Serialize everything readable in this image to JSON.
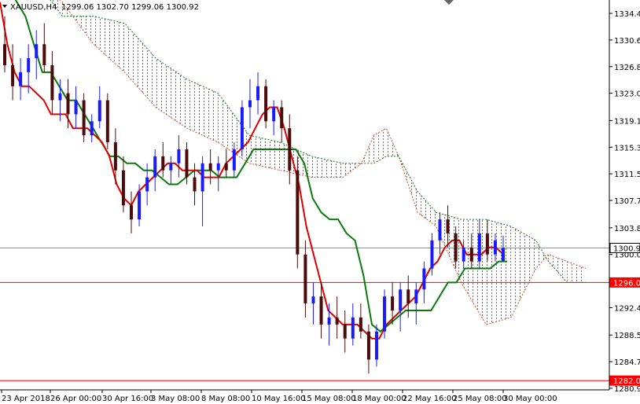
{
  "header": {
    "symbol": "XAUUSD,H4",
    "ohlc": "1299.06 1302.70 1299.06 1300.92"
  },
  "colors": {
    "bull_candle": "#1a1aff",
    "bear_candle": "#4d0a0a",
    "tenkan": "#e00000",
    "kijun": "#0a7a0a",
    "kumo_bear": "#d24a2a",
    "kumo_bull": "#2aa070",
    "horizontal_red": "#ff0000",
    "current_price_line": "#7a9c9c",
    "axis": "#000000"
  },
  "chart_data": {
    "type": "candlestick",
    "indicator": "Ichimoku Kinko Hyo",
    "ylim": [
      1280.9,
      1336.2
    ],
    "y_ticks": [
      1334.4,
      1330.6,
      1326.8,
      1323.0,
      1319.1,
      1315.3,
      1311.5,
      1307.7,
      1303.8,
      1300.0,
      1296.2,
      1292.4,
      1288.5,
      1284.7,
      1280.9
    ],
    "x_ticks": [
      "23 Apr 2018",
      "26 Apr 00:00",
      "30 Apr 16:00",
      "3 May 08:00",
      "8 May 08:00",
      "10 May 16:00",
      "15 May 08:00",
      "18 May 00:00",
      "22 May 16:00",
      "25 May 08:00",
      "30 May 00:00"
    ],
    "current_price": 1300.92,
    "horizontal_lines": [
      1296.0,
      1282.0
    ],
    "price_tags": [
      {
        "label": "1300.92",
        "value": 1300.92,
        "style": "current"
      },
      {
        "label": "1296.00",
        "value": 1296.0,
        "style": "red"
      },
      {
        "label": "1282.00",
        "value": 1282.0,
        "style": "red"
      }
    ],
    "close_points": [
      1332,
      1326,
      1330,
      1324,
      1322,
      1328,
      1332,
      1326,
      1324,
      1322,
      1320,
      1322,
      1318,
      1317,
      1320,
      1322,
      1318,
      1315,
      1313,
      1310,
      1306,
      1308,
      1306,
      1309,
      1313,
      1315,
      1313,
      1310,
      1312,
      1310,
      1312,
      1316,
      1314,
      1312,
      1314,
      1313,
      1312,
      1308,
      1311,
      1312,
      1314,
      1313,
      1316,
      1320,
      1322,
      1321,
      1318,
      1324,
      1322,
      1320,
      1318,
      1314,
      1312,
      1302,
      1294,
      1292,
      1293,
      1290,
      1291,
      1289,
      1289,
      1287,
      1286,
      1289,
      1291,
      1293,
      1295,
      1293,
      1296,
      1297,
      1301,
      1305,
      1306,
      1302,
      1300,
      1299,
      1298,
      1300,
      1301,
      1302,
      1300,
      1301
    ],
    "kumo": [
      {
        "x": 0,
        "span_a": 1340,
        "span_b": 1340
      },
      {
        "x": 5,
        "span_a": 1340,
        "span_b": 1340
      },
      {
        "x": 10,
        "span_a": 1336,
        "span_b": 1334
      },
      {
        "x": 15,
        "span_a": 1330,
        "span_b": 1334
      },
      {
        "x": 20,
        "span_a": 1326,
        "span_b": 1333
      },
      {
        "x": 25,
        "span_a": 1321,
        "span_b": 1328
      },
      {
        "x": 30,
        "span_a": 1318,
        "span_b": 1325
      },
      {
        "x": 35,
        "span_a": 1316,
        "span_b": 1323
      },
      {
        "x": 40,
        "span_a": 1313,
        "span_b": 1317
      },
      {
        "x": 45,
        "span_a": 1312,
        "span_b": 1316
      },
      {
        "x": 50,
        "span_a": 1311,
        "span_b": 1314
      },
      {
        "x": 55,
        "span_a": 1311,
        "span_b": 1313
      },
      {
        "x": 58,
        "span_a": 1313,
        "span_b": 1313
      },
      {
        "x": 60,
        "span_a": 1317,
        "span_b": 1313
      },
      {
        "x": 62,
        "span_a": 1318,
        "span_b": 1314
      },
      {
        "x": 64,
        "span_a": 1314,
        "span_b": 1314
      },
      {
        "x": 67,
        "span_a": 1306,
        "span_b": 1309
      },
      {
        "x": 70,
        "span_a": 1304,
        "span_b": 1306
      },
      {
        "x": 74,
        "span_a": 1296,
        "span_b": 1305
      },
      {
        "x": 78,
        "span_a": 1290,
        "span_b": 1305
      },
      {
        "x": 82,
        "span_a": 1291,
        "span_b": 1304
      },
      {
        "x": 86,
        "span_a": 1298,
        "span_b": 1302
      },
      {
        "x": 88,
        "span_a": 1300,
        "span_b": 1299
      },
      {
        "x": 91,
        "span_a": 1299,
        "span_b": 1296
      },
      {
        "x": 94,
        "span_a": 1298,
        "span_b": 1296
      }
    ],
    "tenkan": [
      1336,
      1330,
      1326,
      1324,
      1324,
      1323,
      1322,
      1320,
      1320,
      1320,
      1318,
      1318,
      1318,
      1317,
      1316,
      1314,
      1310,
      1308,
      1307,
      1309,
      1310,
      1311,
      1312,
      1313,
      1313,
      1312,
      1312,
      1312,
      1311,
      1311,
      1311,
      1313,
      1314,
      1315,
      1316,
      1318,
      1320,
      1321,
      1321,
      1318,
      1314,
      1310,
      1304,
      1300,
      1296,
      1292,
      1291,
      1290,
      1290,
      1290,
      1289,
      1288,
      1288,
      1290,
      1291,
      1292,
      1293,
      1294,
      1296,
      1298,
      1299,
      1301,
      1302,
      1302,
      1300,
      1300,
      1300,
      1301,
      1301,
      1300
    ],
    "kijun": [
      1340,
      1338,
      1336,
      1334,
      1330,
      1326,
      1326,
      1324,
      1322,
      1322,
      1320,
      1318,
      1316,
      1314,
      1314,
      1313,
      1313,
      1312,
      1312,
      1311,
      1310,
      1310,
      1311,
      1312,
      1312,
      1312,
      1311,
      1311,
      1311,
      1313,
      1315,
      1315,
      1315,
      1315,
      1315,
      1315,
      1313,
      1308,
      1306,
      1305,
      1305,
      1303,
      1302,
      1297,
      1290,
      1289,
      1290,
      1291,
      1292,
      1292,
      1292,
      1292,
      1294,
      1296,
      1296,
      1298,
      1298,
      1298,
      1298,
      1299,
      1299
    ],
    "candles": [
      {
        "o": 1330,
        "h": 1334,
        "l": 1326,
        "c": 1327
      },
      {
        "o": 1327,
        "h": 1330,
        "l": 1322,
        "c": 1324
      },
      {
        "o": 1324,
        "h": 1328,
        "l": 1322,
        "c": 1326
      },
      {
        "o": 1326,
        "h": 1330,
        "l": 1323,
        "c": 1328
      },
      {
        "o": 1328,
        "h": 1332,
        "l": 1325,
        "c": 1330
      },
      {
        "o": 1330,
        "h": 1333,
        "l": 1326,
        "c": 1327
      },
      {
        "o": 1327,
        "h": 1329,
        "l": 1320,
        "c": 1322
      },
      {
        "o": 1322,
        "h": 1325,
        "l": 1319,
        "c": 1323
      },
      {
        "o": 1323,
        "h": 1325,
        "l": 1318,
        "c": 1320
      },
      {
        "o": 1320,
        "h": 1324,
        "l": 1318,
        "c": 1322
      },
      {
        "o": 1322,
        "h": 1323,
        "l": 1316,
        "c": 1317
      },
      {
        "o": 1317,
        "h": 1320,
        "l": 1316,
        "c": 1319
      },
      {
        "o": 1319,
        "h": 1324,
        "l": 1318,
        "c": 1322
      },
      {
        "o": 1322,
        "h": 1323,
        "l": 1315,
        "c": 1316
      },
      {
        "o": 1316,
        "h": 1318,
        "l": 1310,
        "c": 1312
      },
      {
        "o": 1312,
        "h": 1314,
        "l": 1306,
        "c": 1307
      },
      {
        "o": 1307,
        "h": 1309,
        "l": 1303,
        "c": 1305
      },
      {
        "o": 1305,
        "h": 1310,
        "l": 1304,
        "c": 1309
      },
      {
        "o": 1309,
        "h": 1313,
        "l": 1307,
        "c": 1311
      },
      {
        "o": 1311,
        "h": 1315,
        "l": 1309,
        "c": 1314
      },
      {
        "o": 1314,
        "h": 1316,
        "l": 1311,
        "c": 1312
      },
      {
        "o": 1312,
        "h": 1314,
        "l": 1310,
        "c": 1313
      },
      {
        "o": 1313,
        "h": 1317,
        "l": 1311,
        "c": 1315
      },
      {
        "o": 1315,
        "h": 1316,
        "l": 1310,
        "c": 1311
      },
      {
        "o": 1311,
        "h": 1313,
        "l": 1307,
        "c": 1309
      },
      {
        "o": 1309,
        "h": 1314,
        "l": 1304,
        "c": 1313
      },
      {
        "o": 1313,
        "h": 1315,
        "l": 1310,
        "c": 1312
      },
      {
        "o": 1312,
        "h": 1314,
        "l": 1309,
        "c": 1313
      },
      {
        "o": 1313,
        "h": 1315,
        "l": 1311,
        "c": 1312
      },
      {
        "o": 1312,
        "h": 1316,
        "l": 1311,
        "c": 1315
      },
      {
        "o": 1315,
        "h": 1322,
        "l": 1314,
        "c": 1321
      },
      {
        "o": 1321,
        "h": 1325,
        "l": 1318,
        "c": 1322
      },
      {
        "o": 1322,
        "h": 1326,
        "l": 1320,
        "c": 1324
      },
      {
        "o": 1324,
        "h": 1325,
        "l": 1318,
        "c": 1319
      },
      {
        "o": 1319,
        "h": 1322,
        "l": 1317,
        "c": 1321
      },
      {
        "o": 1321,
        "h": 1322,
        "l": 1316,
        "c": 1318
      },
      {
        "o": 1318,
        "h": 1320,
        "l": 1310,
        "c": 1312
      },
      {
        "o": 1312,
        "h": 1314,
        "l": 1298,
        "c": 1300
      },
      {
        "o": 1300,
        "h": 1302,
        "l": 1291,
        "c": 1293
      },
      {
        "o": 1293,
        "h": 1296,
        "l": 1290,
        "c": 1294
      },
      {
        "o": 1294,
        "h": 1296,
        "l": 1288,
        "c": 1290
      },
      {
        "o": 1290,
        "h": 1293,
        "l": 1287,
        "c": 1291
      },
      {
        "o": 1291,
        "h": 1294,
        "l": 1288,
        "c": 1290
      },
      {
        "o": 1290,
        "h": 1292,
        "l": 1286,
        "c": 1288
      },
      {
        "o": 1288,
        "h": 1293,
        "l": 1287,
        "c": 1291
      },
      {
        "o": 1291,
        "h": 1293,
        "l": 1288,
        "c": 1289
      },
      {
        "o": 1289,
        "h": 1290,
        "l": 1283,
        "c": 1285
      },
      {
        "o": 1285,
        "h": 1290,
        "l": 1284,
        "c": 1289
      },
      {
        "o": 1289,
        "h": 1295,
        "l": 1288,
        "c": 1294
      },
      {
        "o": 1294,
        "h": 1296,
        "l": 1290,
        "c": 1292
      },
      {
        "o": 1292,
        "h": 1296,
        "l": 1289,
        "c": 1295
      },
      {
        "o": 1295,
        "h": 1297,
        "l": 1291,
        "c": 1293
      },
      {
        "o": 1293,
        "h": 1296,
        "l": 1290,
        "c": 1295
      },
      {
        "o": 1295,
        "h": 1299,
        "l": 1293,
        "c": 1298
      },
      {
        "o": 1298,
        "h": 1303,
        "l": 1297,
        "c": 1302
      },
      {
        "o": 1302,
        "h": 1306,
        "l": 1300,
        "c": 1305
      },
      {
        "o": 1305,
        "h": 1307,
        "l": 1301,
        "c": 1303
      },
      {
        "o": 1303,
        "h": 1304,
        "l": 1298,
        "c": 1299
      },
      {
        "o": 1299,
        "h": 1302,
        "l": 1298,
        "c": 1301
      },
      {
        "o": 1301,
        "h": 1303,
        "l": 1298,
        "c": 1299
      },
      {
        "o": 1299,
        "h": 1305,
        "l": 1298,
        "c": 1303
      },
      {
        "o": 1303,
        "h": 1305,
        "l": 1299,
        "c": 1300
      },
      {
        "o": 1300,
        "h": 1303,
        "l": 1299,
        "c": 1302
      },
      {
        "o": 1299.06,
        "h": 1302.7,
        "l": 1299.06,
        "c": 1300.92
      }
    ]
  }
}
